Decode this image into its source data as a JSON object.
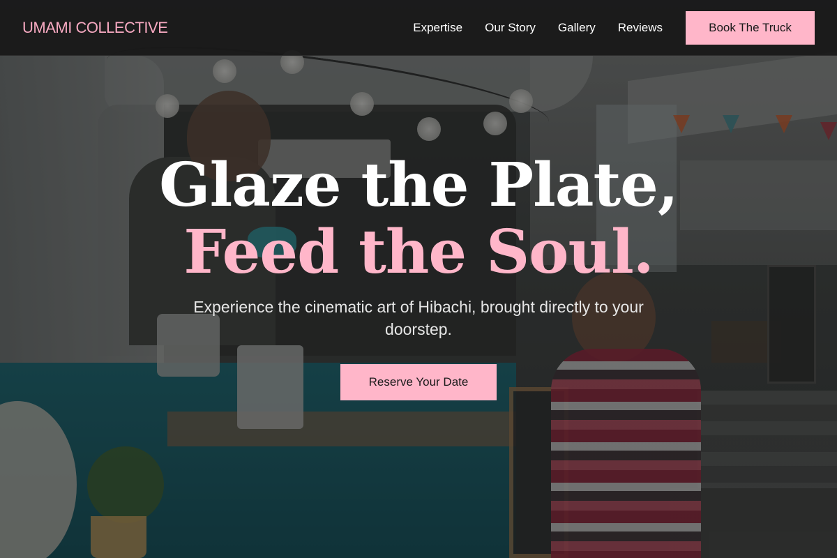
{
  "brand": {
    "name": "UMAMI COLLECTIVE"
  },
  "nav": {
    "links": [
      "Expertise",
      "Our Story",
      "Gallery",
      "Reviews"
    ],
    "cta_label": "Book The Truck"
  },
  "hero": {
    "headline_line1": "Glaze the Plate,",
    "headline_line2": "Feed the Soul.",
    "subtitle": "Experience the cinematic art of Hibachi, brought directly to your doorstep.",
    "cta_label": "Reserve Your Date",
    "background_image": "food-truck-scene"
  },
  "colors": {
    "accent": "#ffb6c9",
    "nav_background": "#1a1a1a",
    "headline": "#ffffff"
  }
}
